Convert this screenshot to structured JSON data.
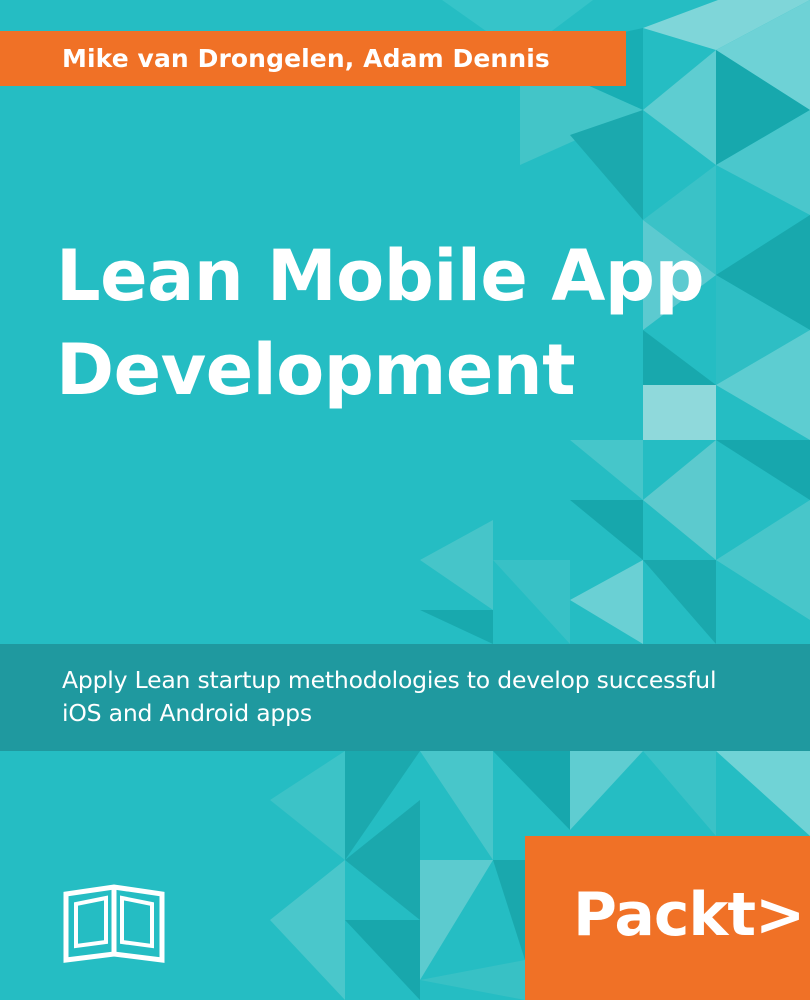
{
  "colors": {
    "background": "#25bdc3",
    "band": "#1f999f",
    "accent": "#f07126",
    "text": "#ffffff"
  },
  "cover": {
    "authors": "Mike van Drongelen, Adam Dennis",
    "title_lines": [
      "Lean Mobile App",
      "Development"
    ],
    "subtitle_lines": [
      "Apply Lean startup methodologies to develop successful",
      "iOS and Android apps"
    ],
    "publisher_logo": "Packt>"
  },
  "icons": {
    "book": "open-book-icon"
  }
}
